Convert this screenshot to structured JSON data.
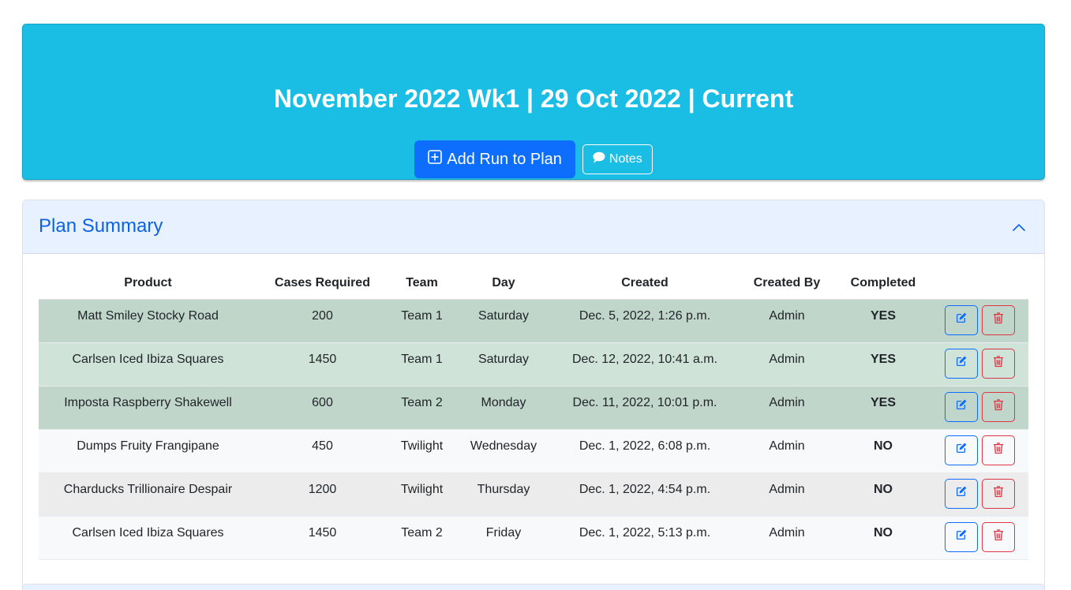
{
  "header": {
    "title": "November 2022 Wk1 | 29 Oct 2022 | Current",
    "add_run_label": "Add Run to Plan",
    "notes_label": "Notes"
  },
  "summary": {
    "title": "Plan Summary",
    "columns": [
      "Product",
      "Cases Required",
      "Team",
      "Day",
      "Created",
      "Created By",
      "Completed",
      ""
    ],
    "rows": [
      {
        "product": "Matt Smiley Stocky Road",
        "cases": "200",
        "team": "Team 1",
        "day": "Saturday",
        "created": "Dec. 5, 2022, 1:26 p.m.",
        "created_by": "Admin",
        "completed": "YES",
        "bg": "#c1d6cb"
      },
      {
        "product": "Carlsen Iced Ibiza Squares",
        "cases": "1450",
        "team": "Team 1",
        "day": "Saturday",
        "created": "Dec. 12, 2022, 10:41 a.m.",
        "created_by": "Admin",
        "completed": "YES",
        "bg": "#cfe3d9"
      },
      {
        "product": "Imposta Raspberry Shakewell",
        "cases": "600",
        "team": "Team 2",
        "day": "Monday",
        "created": "Dec. 11, 2022, 10:01 p.m.",
        "created_by": "Admin",
        "completed": "YES",
        "bg": "#c1d6cb"
      },
      {
        "product": "Dumps Fruity Frangipane",
        "cases": "450",
        "team": "Twilight",
        "day": "Wednesday",
        "created": "Dec. 1, 2022, 6:08 p.m.",
        "created_by": "Admin",
        "completed": "NO",
        "bg": "#f8f9fa"
      },
      {
        "product": "Charducks Trillionaire Despair",
        "cases": "1200",
        "team": "Twilight",
        "day": "Thursday",
        "created": "Dec. 1, 2022, 4:54 p.m.",
        "created_by": "Admin",
        "completed": "NO",
        "bg": "#ececed"
      },
      {
        "product": "Carlsen Iced Ibiza Squares",
        "cases": "1450",
        "team": "Team 2",
        "day": "Friday",
        "created": "Dec. 1, 2022, 5:13 p.m.",
        "created_by": "Admin",
        "completed": "NO",
        "bg": "#f8f9fa"
      }
    ]
  },
  "colors": {
    "hero_bg": "#1abde4",
    "primary": "#0d6efd",
    "danger": "#dc3545",
    "accordion_header": "#e7f1ff",
    "accordion_title": "#0c63e4"
  },
  "icons": {
    "add": "plus-square-icon",
    "notes": "chat-bubble-icon",
    "collapse": "chevron-up-icon",
    "edit": "pencil-square-icon",
    "delete": "trash-icon"
  }
}
